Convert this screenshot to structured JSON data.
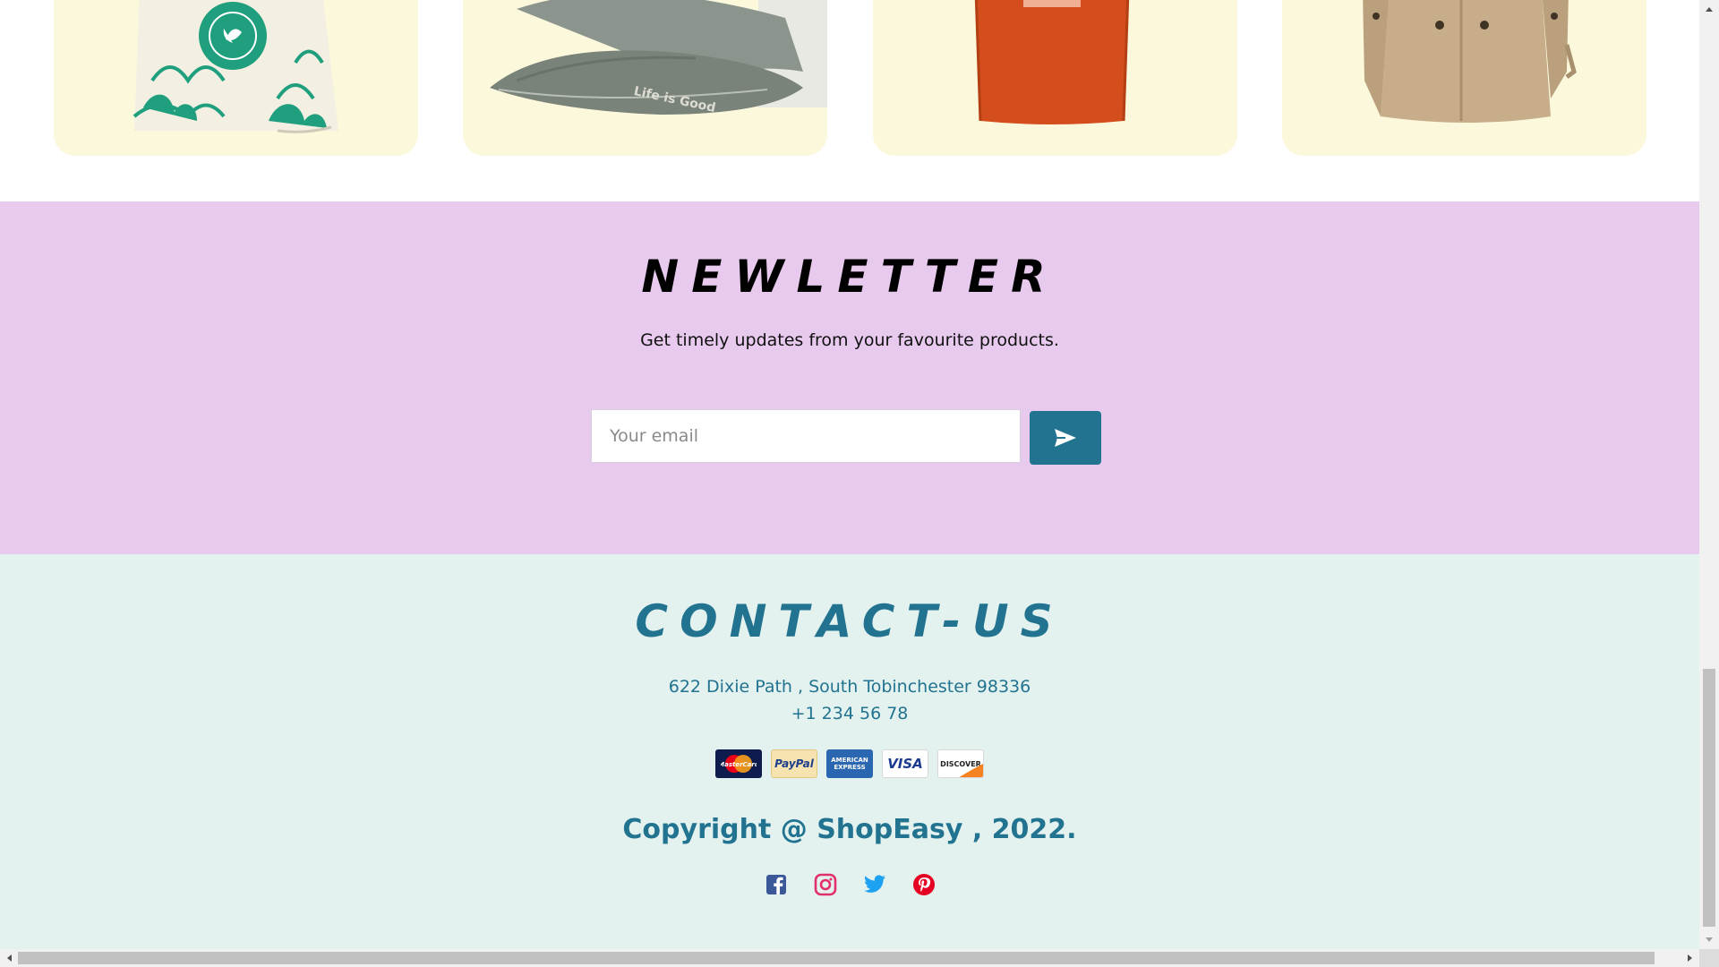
{
  "products": [
    {
      "name": "eco-tote-bag",
      "alt": "Tote bag with leaf print"
    },
    {
      "name": "grey-cap",
      "alt": "Grey baseball cap",
      "print": "Life is Good"
    },
    {
      "name": "orange-tshirt",
      "alt": "Orange t-shirt"
    },
    {
      "name": "trench-coat",
      "alt": "Beige trench coat"
    }
  ],
  "newsletter": {
    "title": "NEWLETTER",
    "subtitle": "Get timely updates from your favourite products.",
    "email_placeholder": "Your email",
    "send_icon": "send-arrow-icon"
  },
  "contact": {
    "title": "CONTACT-US",
    "address": "622 Dixie Path , South Tobinchester 98336",
    "phone": "+1 234 56 78",
    "payment_methods": [
      {
        "name": "mastercard",
        "label": "MasterCard"
      },
      {
        "name": "paypal",
        "label": "PayPal"
      },
      {
        "name": "amex",
        "label": "AMERICAN EXPRESS"
      },
      {
        "name": "visa",
        "label": "VISA"
      },
      {
        "name": "discover",
        "label": "DISCOVER"
      }
    ],
    "copyright": "Copyright @ ShopEasy , 2022.",
    "socials": [
      {
        "name": "facebook-icon",
        "color": "#3b5998"
      },
      {
        "name": "instagram-icon",
        "color": "#e1306c"
      },
      {
        "name": "twitter-icon",
        "color": "#1da1f2"
      },
      {
        "name": "pinterest-icon",
        "color": "#e60023"
      }
    ]
  },
  "colors": {
    "accent": "#227390",
    "newsletter_bg": "#e8caee",
    "contact_bg": "#e3f2ef",
    "card_bg": "#fbf8dc"
  }
}
